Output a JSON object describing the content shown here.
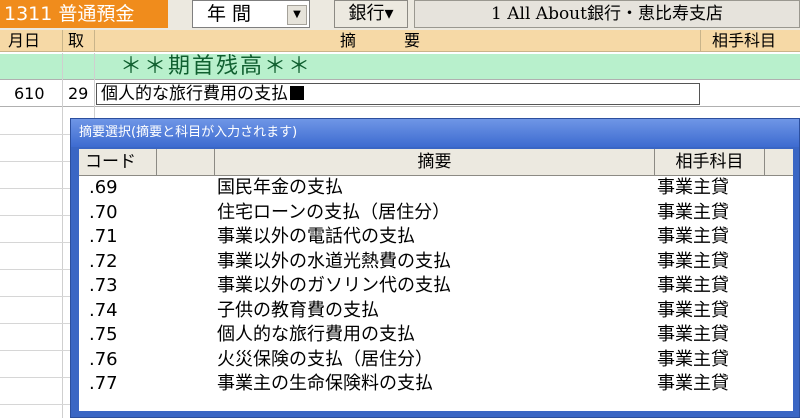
{
  "toolbar": {
    "account": "1311  普通預金",
    "period": "年 間",
    "bank_button": "銀行▾",
    "bank_name": "1 All About銀行・恵比寿支店"
  },
  "ledger_header": {
    "month_day": "月日",
    "torihiki": "取",
    "summary": "摘　　　要",
    "counter_account": "相手科目"
  },
  "ledger": {
    "opening_balance": "＊＊期首残高＊＊",
    "entry": {
      "code": "610",
      "day": "29",
      "summary": "個人的な旅行費用の支払"
    }
  },
  "dialog": {
    "title": "摘要選択(摘要と科目が入力されます)",
    "columns": {
      "code": "コード",
      "summary": "摘要",
      "account": "相手科目"
    },
    "rows": [
      {
        "code": ".69",
        "summary": "国民年金の支払",
        "account": "事業主貸"
      },
      {
        "code": ".70",
        "summary": "住宅ローンの支払（居住分）",
        "account": "事業主貸"
      },
      {
        "code": ".71",
        "summary": "事業以外の電話代の支払",
        "account": "事業主貸"
      },
      {
        "code": ".72",
        "summary": "事業以外の水道光熱費の支払",
        "account": "事業主貸"
      },
      {
        "code": ".73",
        "summary": "事業以外のガソリン代の支払",
        "account": "事業主貸"
      },
      {
        "code": ".74",
        "summary": "子供の教育費の支払",
        "account": "事業主貸"
      },
      {
        "code": ".75",
        "summary": "個人的な旅行費用の支払",
        "account": "事業主貸"
      },
      {
        "code": ".76",
        "summary": "火災保険の支払（居住分）",
        "account": "事業主貸"
      },
      {
        "code": ".77",
        "summary": "事業主の生命保険料の支払",
        "account": "事業主貸"
      }
    ]
  },
  "colors": {
    "account_badge": "#f08c1c",
    "header_bg": "#f6d9a6",
    "opening_row": "#b8f0cc",
    "dialog_frame": "#3a66c4"
  }
}
